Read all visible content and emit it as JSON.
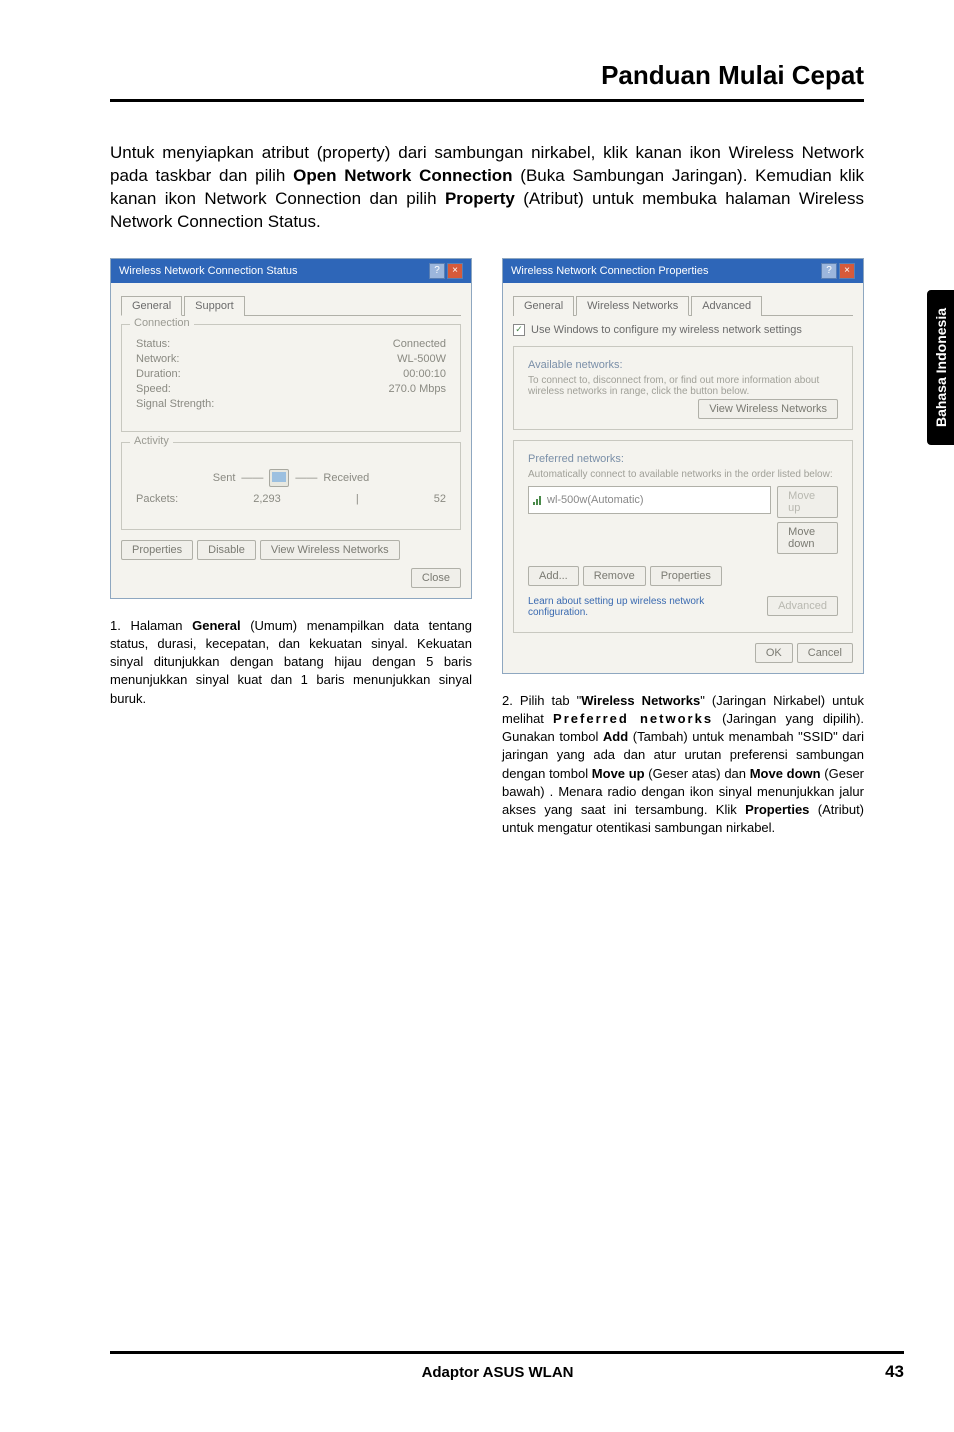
{
  "page": {
    "title": "Panduan Mulai Cepat",
    "intro_pre": "Untuk menyiapkan atribut (property) dari sambungan nirkabel, klik kanan ikon Wireless Network pada taskbar dan pilih ",
    "intro_b1": "Open Network Connection",
    "intro_mid1": " (Buka Sambungan Jaringan). Kemudian klik kanan ikon Network Connection dan pilih ",
    "intro_b2": "Property",
    "intro_post": " (Atribut) untuk membuka halaman Wireless Network Connection Status."
  },
  "sidebar": {
    "label": "Bahasa Indonesia"
  },
  "dlg1": {
    "title": "Wireless Network Connection Status",
    "tabs": {
      "general": "General",
      "support": "Support"
    },
    "conn_legend": "Connection",
    "status_label": "Status:",
    "status_value": "Connected",
    "network_label": "Network:",
    "network_value": "WL-500W",
    "duration_label": "Duration:",
    "duration_value": "00:00:10",
    "speed_label": "Speed:",
    "speed_value": "270.0 Mbps",
    "signal_label": "Signal Strength:",
    "activity_legend": "Activity",
    "sent": "Sent",
    "received": "Received",
    "packets_label": "Packets:",
    "packets_sent": "2,293",
    "packets_recv": "52",
    "btn_properties": "Properties",
    "btn_disable": "Disable",
    "btn_view": "View Wireless Networks",
    "btn_close": "Close"
  },
  "dlg2": {
    "title": "Wireless Network Connection Properties",
    "tabs": {
      "general": "General",
      "wireless": "Wireless Networks",
      "advanced": "Advanced"
    },
    "chk_label": "Use Windows to configure my wireless network settings",
    "avail_head": "Available networks:",
    "avail_help": "To connect to, disconnect from, or find out more information about wireless networks in range, click the button below.",
    "btn_view": "View Wireless Networks",
    "pref_head": "Preferred networks:",
    "pref_help": "Automatically connect to available networks in the order listed below:",
    "list_item": "wl-500w(Automatic)",
    "btn_moveup": "Move up",
    "btn_movedown": "Move down",
    "btn_add": "Add...",
    "btn_remove": "Remove",
    "btn_props": "Properties",
    "learn": "Learn about setting up wireless network configuration.",
    "btn_advanced": "Advanced",
    "btn_ok": "OK",
    "btn_cancel": "Cancel"
  },
  "cap1": {
    "num": "1. ",
    "t1": "Halaman ",
    "b1": "General",
    "t2": " (Umum) menampilkan data tentang status, durasi, kecepatan, dan kekuatan sinyal. Kekuatan sinyal ditunjukkan dengan batang hijau dengan 5 baris menunjukkan sinyal kuat dan 1 baris menunjukkan sinyal buruk."
  },
  "cap2": {
    "num": "2. ",
    "t1": "Pilih tab \"",
    "b1": "Wireless Networks",
    "t2": "\" (Jaringan Nirkabel) untuk melihat ",
    "b2": "Preferred networks",
    "t3": " (Jaringan yang dipilih). Gunakan tombol ",
    "b3": "Add",
    "t4": " (Tambah) untuk menambah \"SSID\" dari jaringan yang ada dan atur urutan preferensi sambungan dengan tombol ",
    "b4": "Move up",
    "t5": " (Geser atas) dan ",
    "b5": "Move down",
    "t6": " (Geser bawah) . Menara radio dengan ikon sinyal menunjukkan jalur akses yang saat ini tersambung. Klik ",
    "b6": "Properties",
    "t7": " (Atribut) untuk mengatur otentikasi sambungan nirkabel."
  },
  "footer": {
    "center": "Adaptor ASUS WLAN",
    "page": "43"
  }
}
